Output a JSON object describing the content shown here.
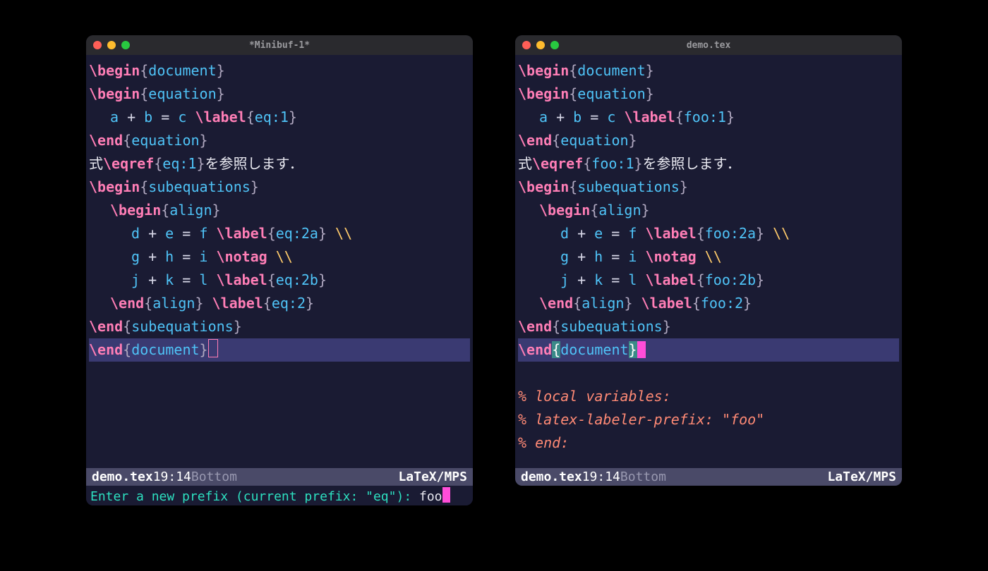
{
  "left": {
    "title": "*Minibuf-1*",
    "prefix": "eq",
    "lines": {
      "l1_cmd": "\\begin",
      "l1_env": "document",
      "l2_cmd": "\\begin",
      "l2_env": "equation",
      "l3_expr_a": "a",
      "l3_expr_b": "b",
      "l3_expr_c": "c",
      "l3_op1": " + ",
      "l3_op2": " = ",
      "l3_lbl": "\\label",
      "l3_ref": "eq:1",
      "l4_cmd": "\\end",
      "l4_env": "equation",
      "l5_pre": "式",
      "l5_cmd": "\\eqref",
      "l5_ref": "eq:1",
      "l5_post": "を参照します．",
      "l6_cmd": "\\begin",
      "l6_env": "subequations",
      "l7_cmd": "\\begin",
      "l7_env": "align",
      "l8_a": "d",
      "l8_b": "e",
      "l8_c": "f",
      "l8_lbl": "\\label",
      "l8_ref": "eq:2a",
      "l8_bs": "\\\\",
      "l9_a": "g",
      "l9_b": "h",
      "l9_c": "i",
      "l9_cmd": "\\notag",
      "l9_bs": "\\\\",
      "l10_a": "j",
      "l10_b": "k",
      "l10_c": "l",
      "l10_lbl": "\\label",
      "l10_ref": "eq:2b",
      "l11_cmd": "\\end",
      "l11_env": "align",
      "l11_lbl": "\\label",
      "l11_ref": "eq:2",
      "l12_cmd": "\\end",
      "l12_env": "subequations",
      "l13_cmd": "\\end",
      "l13_env": "document"
    },
    "modeline": {
      "file": "demo.tex",
      "pos": "19:14",
      "where": "Bottom",
      "mode": "LaTeX/MPS"
    },
    "minibuf": {
      "prompt": "Enter a new prefix (current prefix: \"eq\"): ",
      "input": "foo"
    }
  },
  "right": {
    "title": "demo.tex",
    "prefix": "foo",
    "lines": {
      "l1_cmd": "\\begin",
      "l1_env": "document",
      "l2_cmd": "\\begin",
      "l2_env": "equation",
      "l3_expr_a": "a",
      "l3_expr_b": "b",
      "l3_expr_c": "c",
      "l3_op1": " + ",
      "l3_op2": " = ",
      "l3_lbl": "\\label",
      "l3_ref": "foo:1",
      "l4_cmd": "\\end",
      "l4_env": "equation",
      "l5_pre": "式",
      "l5_cmd": "\\eqref",
      "l5_ref": "foo:1",
      "l5_post": "を参照します．",
      "l6_cmd": "\\begin",
      "l6_env": "subequations",
      "l7_cmd": "\\begin",
      "l7_env": "align",
      "l8_a": "d",
      "l8_b": "e",
      "l8_c": "f",
      "l8_lbl": "\\label",
      "l8_ref": "foo:2a",
      "l8_bs": "\\\\",
      "l9_a": "g",
      "l9_b": "h",
      "l9_c": "i",
      "l9_cmd": "\\notag",
      "l9_bs": "\\\\",
      "l10_a": "j",
      "l10_b": "k",
      "l10_c": "l",
      "l10_lbl": "\\label",
      "l10_ref": "foo:2b",
      "l11_cmd": "\\end",
      "l11_env": "align",
      "l11_lbl": "\\label",
      "l11_ref": "foo:2",
      "l12_cmd": "\\end",
      "l12_env": "subequations",
      "l13_cmd": "\\end",
      "l13_env": "document",
      "lv1": "% local variables:",
      "lv2": "% latex-labeler-prefix: \"foo\"",
      "lv3": "% end:"
    },
    "modeline": {
      "file": "demo.tex",
      "pos": "19:14",
      "where": "Bottom",
      "mode": "LaTeX/MPS"
    }
  }
}
